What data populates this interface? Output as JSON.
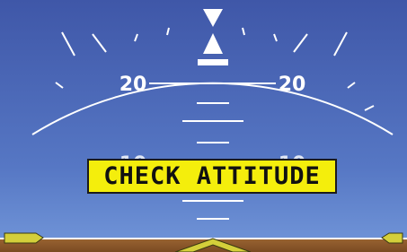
{
  "pitch_scale": {
    "upper_left_label": "20",
    "upper_right_label": "20",
    "lower_left_label": "10",
    "lower_right_label": "10"
  },
  "warning": {
    "text": "CHECK ATTITUDE"
  },
  "colors": {
    "sky_top": "#3f57a8",
    "sky_bottom": "#6c8fd3",
    "ground": "#8d5a2f",
    "horizon_line": "#ffffff",
    "warning_bg": "#f4ee0c",
    "aircraft_symbol": "#d4cf3a"
  },
  "icons": {
    "roll_pointer": "roll-pointer-triangle-icon",
    "sky_pointer": "sky-pointer-triangle-icon",
    "aircraft_wings": "aircraft-symbol-icon"
  }
}
